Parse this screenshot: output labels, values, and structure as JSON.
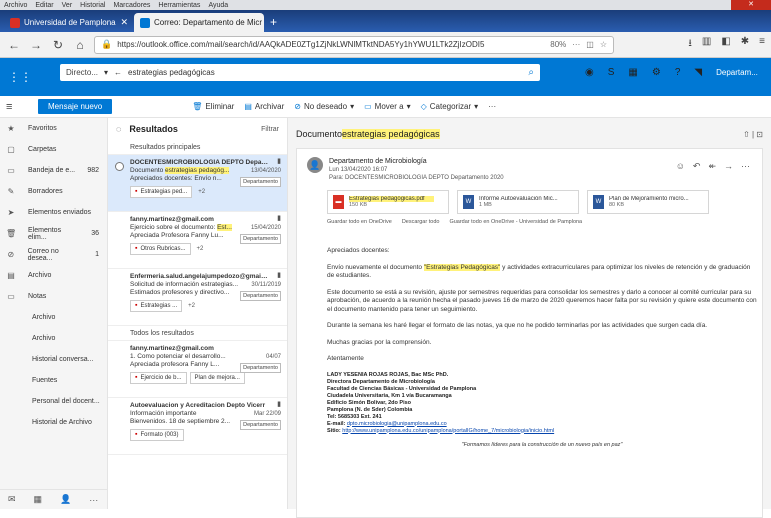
{
  "browser": {
    "menu": [
      "Archivo",
      "Editar",
      "Ver",
      "Historial",
      "Marcadores",
      "Herramientas",
      "Ayuda"
    ],
    "tabs": [
      {
        "label": "Universidad de Pamplona",
        "color": "#d93025"
      },
      {
        "label": "Correo: Departamento de Micr",
        "color": "#0078d4"
      }
    ],
    "url": "https://outlook.office.com/mail/search/id/AAQkADE0ZTg1ZjNkLWNlMTktNDA5Yy1hYWU1LTk2ZjIzODI5",
    "zoom": "80%"
  },
  "owa": {
    "scope_label": "Directo...",
    "search_text": "estrategias pedagógicas",
    "user_label": "Departam..."
  },
  "toolbar": {
    "new_message": "Mensaje nuevo",
    "delete": "Eliminar",
    "archive": "Archivar",
    "junk": "No deseado",
    "move": "Mover a",
    "categorize": "Categorizar",
    "more": "···"
  },
  "sidebar": {
    "items": [
      {
        "icon": "★",
        "label": "Favoritos",
        "count": ""
      },
      {
        "icon": "▢",
        "label": "Carpetas",
        "count": ""
      },
      {
        "icon": "▭",
        "label": "Bandeja de e...",
        "count": "982"
      },
      {
        "icon": "✎",
        "label": "Borradores",
        "count": ""
      },
      {
        "icon": "➤",
        "label": "Elementos enviados",
        "count": ""
      },
      {
        "icon": "🗑",
        "label": "Elementos elim...",
        "count": "36"
      },
      {
        "icon": "⊘",
        "label": "Correo no desea...",
        "count": "1"
      },
      {
        "icon": "▤",
        "label": "Archivo",
        "count": ""
      },
      {
        "icon": "▭",
        "label": "Notas",
        "count": ""
      },
      {
        "icon": "",
        "label": "Archivo",
        "count": "",
        "sub": true
      },
      {
        "icon": "",
        "label": "Archivo",
        "count": "",
        "sub": true
      },
      {
        "icon": "",
        "label": "Historial conversa...",
        "count": "",
        "sub": true
      },
      {
        "icon": "",
        "label": "Fuentes",
        "count": "",
        "sub": true
      },
      {
        "icon": "",
        "label": "Personal del docent...",
        "count": "",
        "sub": true
      },
      {
        "icon": "",
        "label": "Historial de Archivo",
        "count": "",
        "sub": true
      }
    ],
    "bottom": [
      "✉",
      "▦",
      "👤",
      "···"
    ]
  },
  "list": {
    "title": "Resultados",
    "filter": "Filtrar",
    "section_top": "Resultados principales",
    "section_all": "Todos los resultados",
    "mails": [
      {
        "from": "DOCENTESMICROBIOLOGIA DEPTO Departamento",
        "l1a": "Documento ",
        "l1h": "estrategias pedagóg...",
        "l2": "Apreciados docentes: Envío n...",
        "date": "13/04/2020",
        "chip": "Departamento",
        "att": "Estrategias ped...",
        "plus": "+2",
        "selected": true
      },
      {
        "from": "fanny.martinez@gmail.com",
        "l1a": "Ejercicio sobre el documento: ",
        "l1h": "Est...",
        "l2": "Apreciada Profesora Fanny Lu...",
        "date": "15/04/2020",
        "chip": "Departamento",
        "att": "Otros Rubricas...",
        "plus": "+2",
        "selected": false
      },
      {
        "from": "Enfermeria.salud.angelajumpedozo@gmail.co",
        "l1a": "Solicitud de información estrategias...",
        "l1h": "",
        "l2": "Estimados profesores y directivo...",
        "date": "30/11/2019",
        "chip": "Departamento",
        "att": "Estrategias ...",
        "plus": "+2",
        "selected": false
      },
      {
        "from": "fanny.martinez@gmail.com",
        "l1a": "1. Como potenciar el desarrollo...",
        "l1h": "",
        "l2": "Apreciada profesora Fanny L...",
        "date": "04/07",
        "chip": "Departamento",
        "att": "Ejercicio de b...",
        "plus": "Plan de mejora...",
        "selected": false
      },
      {
        "from": "Autoevaluacion y Acreditacion Depto Vicerr",
        "l1a": "Información importante",
        "l1h": "",
        "l2": "Bienvenidos. 18 de septiembre 2...",
        "date": "Mar 22/09",
        "chip": "Departamento",
        "att": "Formato (003)",
        "plus": "",
        "selected": false
      }
    ]
  },
  "reading": {
    "subject_a": "Documento ",
    "subject_h": "estrategias pedagógicas",
    "sender": "Departamento de Microbiología",
    "to": "Lun 13/04/2020 16:07",
    "meta": "Para: DOCENTESMICROBIOLOGIA DEPTO Departamento 2020",
    "attachments": [
      {
        "name": "Estrategias pedagógicas.pdf",
        "size": "150 KB",
        "kind": "pdf",
        "color": "#d93025"
      },
      {
        "name": "Informe Autoevaluación Mic...",
        "size": "1 MB",
        "kind": "doc",
        "color": "#2b579a"
      },
      {
        "name": "Plan de Mejoramiento micro...",
        "size": "80 KB",
        "kind": "doc",
        "color": "#2b579a"
      }
    ],
    "att_actions": [
      "Guardar todo en OneDrive",
      "Descargar todo",
      "Guardar todo en OneDrive - Universidad de Pamplona"
    ],
    "greeting": "Apreciados docentes:",
    "p1a": "Envío nuevamente el documento ",
    "p1h": "\"Estrategias Pedagógicas\"",
    "p1b": " y actividades extracurriculares para optimizar los niveles de retención y de graduación de estudiantes.",
    "p2": "Este documento se está a su revisión, ajuste por semestres requeridas para consolidar los semestres y darlo a conocer al comité curricular para su aprobación, de acuerdo a la reunión hecha el pasado jueves 16 de marzo de 2020 queremos hacer falta por su revisión y quiere este documento con el documento mantenido para tener un seguimiento.",
    "p3": "Durante la semana les haré llegar el formato de las notas, ya que no he podido terminarlas por las actividades que surgen cada día.",
    "p4": "Muchas gracias por la comprensión.",
    "closing": "Atentamente",
    "sig": [
      "LADY YESENIA ROJAS ROJAS, Bac MSc PhD.",
      "Directora Departamento de Microbiología",
      "Facultad de Ciencias Básicas - Universidad de Pamplona",
      "Ciudadela Universitaria, Km 1 vía Bucaramanga",
      "Edificio Simón Bolívar, 2do Piso",
      "Pamplona (N. de Sder) Colombia",
      "Tel: 5685303 Ext. 241"
    ],
    "sig_email_label": "E-mail: ",
    "sig_email": "dpto.microbiologia@unipamplona.edu.co",
    "sig_web_label": "Sitio: ",
    "sig_web": "http://www.unipamplona.edu.co/unipamplona/portalIG/home_7/microbiologia/inicio.html",
    "footer": "\"Formamos líderes para la construcción de un nuevo país en paz\""
  }
}
